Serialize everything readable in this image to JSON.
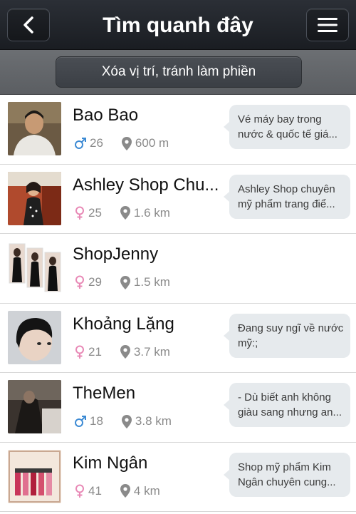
{
  "nav": {
    "title": "Tìm quanh đây",
    "back_icon": "chevron-left-icon",
    "menu_icon": "hamburger-menu-icon"
  },
  "sub_bar": {
    "clear_location_label": "Xóa vị trí, tránh làm phiền"
  },
  "colors": {
    "male": "#3d8bd4",
    "female": "#e889b6",
    "meta_text": "#8a8a8a",
    "bubble": "#e6eaed"
  },
  "people": [
    {
      "name": "Bao Bao",
      "gender": "male",
      "age": "26",
      "distance": "600 m",
      "status_line1": "Vé máy bay trong",
      "status_line2": "nước & quốc tế giá..."
    },
    {
      "name": "Ashley Shop Chu...",
      "gender": "female",
      "age": "25",
      "distance": "1.6 km",
      "status_line1": "Ashley Shop chuyên",
      "status_line2": "mỹ phẩm trang điể..."
    },
    {
      "name": "ShopJenny",
      "gender": "female",
      "age": "29",
      "distance": "1.5 km",
      "status_line1": "",
      "status_line2": ""
    },
    {
      "name": "Khoảng Lặng",
      "gender": "female",
      "age": "21",
      "distance": "3.7 km",
      "status_line1": "Đang suy ngĩ về nước",
      "status_line2": "mỹ:;"
    },
    {
      "name": "TheMen",
      "gender": "male",
      "age": "18",
      "distance": "3.8 km",
      "status_line1": "- Dù biết anh không",
      "status_line2": "giàu sang nhưng an..."
    },
    {
      "name": "Kim Ngân",
      "gender": "female",
      "age": "41",
      "distance": "4 km",
      "status_line1": "Shop mỹ phẩm Kim",
      "status_line2": "Ngân chuyên cung..."
    }
  ]
}
